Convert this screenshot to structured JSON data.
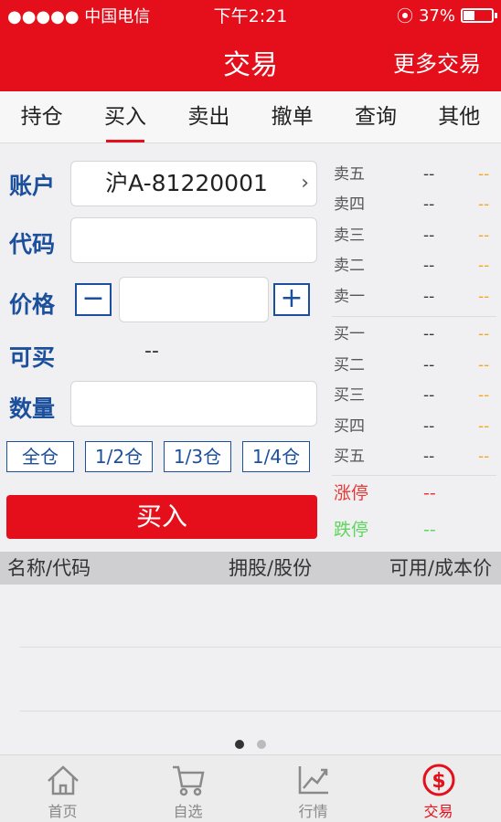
{
  "status": {
    "carrier": "●●●●● 中国电信",
    "time": "下午2:21",
    "battery": "37%"
  },
  "nav": {
    "title": "交易",
    "more": "更多交易"
  },
  "tabs": [
    "持仓",
    "买入",
    "卖出",
    "撤单",
    "查询",
    "其他"
  ],
  "active_tab": "买入",
  "form": {
    "account_label": "账户",
    "account_value": "沪A-81220001",
    "code_label": "代码",
    "code_value": "",
    "price_label": "价格",
    "price_value": "",
    "minus": "−",
    "plus": "+",
    "available_label": "可买",
    "available_value": "--",
    "quantity_label": "数量",
    "quantity_value": "",
    "ratios": [
      "全仓",
      "1/2仓",
      "1/3仓",
      "1/4仓"
    ],
    "buy_button": "买入"
  },
  "order_book": {
    "sell": [
      {
        "label": "卖五",
        "price": "--",
        "volume": "--"
      },
      {
        "label": "卖四",
        "price": "--",
        "volume": "--"
      },
      {
        "label": "卖三",
        "price": "--",
        "volume": "--"
      },
      {
        "label": "卖二",
        "price": "--",
        "volume": "--"
      },
      {
        "label": "卖一",
        "price": "--",
        "volume": "--"
      }
    ],
    "buy": [
      {
        "label": "买一",
        "price": "--",
        "volume": "--"
      },
      {
        "label": "买二",
        "price": "--",
        "volume": "--"
      },
      {
        "label": "买三",
        "price": "--",
        "volume": "--"
      },
      {
        "label": "买四",
        "price": "--",
        "volume": "--"
      },
      {
        "label": "买五",
        "price": "--",
        "volume": "--"
      }
    ],
    "limit_up_label": "涨停",
    "limit_up_value": "--",
    "limit_down_label": "跌停",
    "limit_down_value": "--",
    "colors": {
      "volume": "#f5a623",
      "limit_up": "#e53935",
      "limit_down": "#5cd65c"
    }
  },
  "holdings": {
    "col1": "名称/代码",
    "col2": "拥股/股份",
    "col3": "可用/成本价"
  },
  "pager": {
    "pages": 2,
    "current": 1
  },
  "bottom_nav": [
    {
      "label": "首页",
      "icon": "home-icon"
    },
    {
      "label": "自选",
      "icon": "cart-icon"
    },
    {
      "label": "行情",
      "icon": "trend-chart-icon"
    },
    {
      "label": "交易",
      "icon": "dollar-icon"
    }
  ],
  "bottom_active": "交易",
  "colors": {
    "brand": "#e50f1b",
    "accent_blue": "#1c4f9c"
  }
}
